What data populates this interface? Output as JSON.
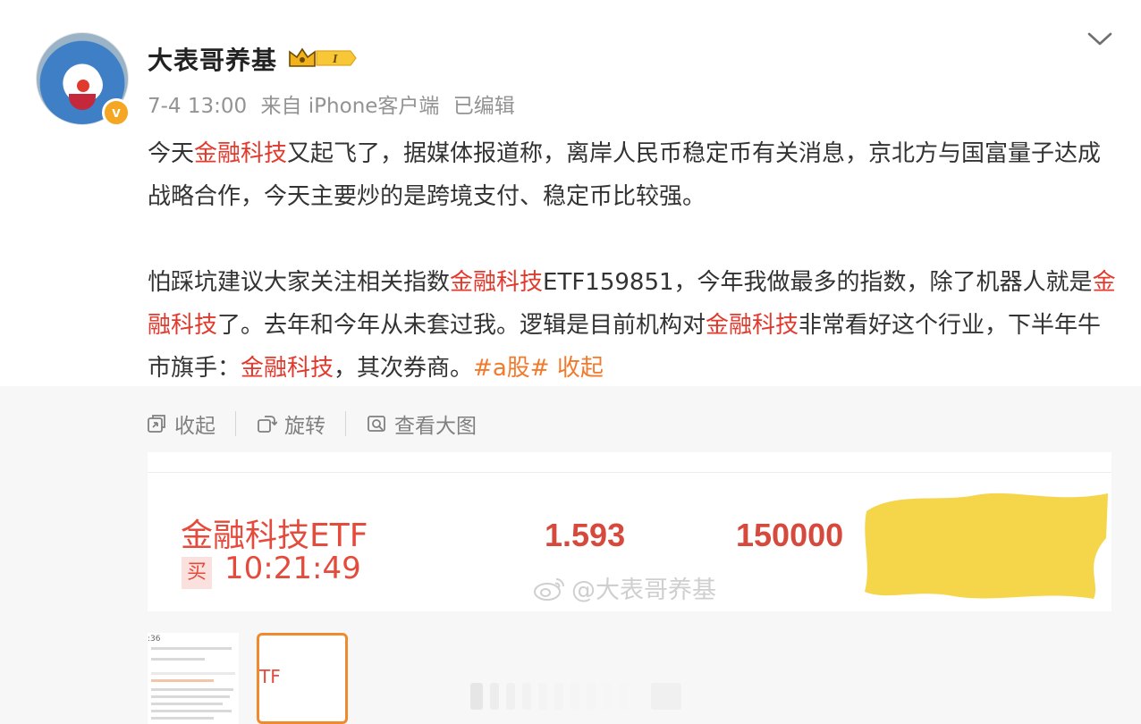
{
  "author": {
    "name": "大表哥养基",
    "avatar_icon": "doraemon-avatar-icon",
    "verified_icon": "verified-v-icon",
    "verified_glyph": "v",
    "rank_badge": "I"
  },
  "meta": {
    "date": "7-4 13:00",
    "source": "来自 iPhone客户端",
    "edited": "已编辑"
  },
  "post": {
    "p1": [
      {
        "t": "今天",
        "hl": false
      },
      {
        "t": "金融科技",
        "hl": true
      },
      {
        "t": "又起飞了，据媒体报道称，离岸人民币稳定币有关消息，京北方与国富量子达成战略合作，今天主要炒的是跨境支付、稳定币比较强。",
        "hl": false
      }
    ],
    "p2": [
      {
        "t": "怕踩坑建议大家关注相关指数",
        "hl": false
      },
      {
        "t": "金融科技",
        "hl": true
      },
      {
        "t": "ETF159851，今年我做最多的指数，除了机器人就是",
        "hl": false
      },
      {
        "t": "金融科技",
        "hl": true
      },
      {
        "t": "了。去年和今年从未套过我。逻辑是目前机构对",
        "hl": false
      },
      {
        "t": "金融科技",
        "hl": true
      },
      {
        "t": "非常看好这个行业，下半年牛市旗手：",
        "hl": false
      },
      {
        "t": "金融科技",
        "hl": true
      },
      {
        "t": "，其次券商。",
        "hl": false
      }
    ],
    "hashtag": "#a股#",
    "collapse_label": "收起"
  },
  "toolbar": {
    "collapse_label": "收起",
    "rotate_label": "旋转",
    "view_large_label": "查看大图"
  },
  "image": {
    "fund_name": "金融科技ETF",
    "buy_label": "买",
    "time": "10:21:49",
    "price": "1.593",
    "quantity": "150000",
    "watermark": "@大表哥养基"
  },
  "thumbnails": [
    {
      "label": ":36",
      "selected": false
    },
    {
      "label": "TF",
      "selected": true
    }
  ],
  "colors": {
    "highlight": "#e3392c",
    "hashtag": "#f27a2c",
    "meta": "#939393",
    "accent_orange": "#f08a2f",
    "redaction_yellow": "#f5d54a"
  }
}
